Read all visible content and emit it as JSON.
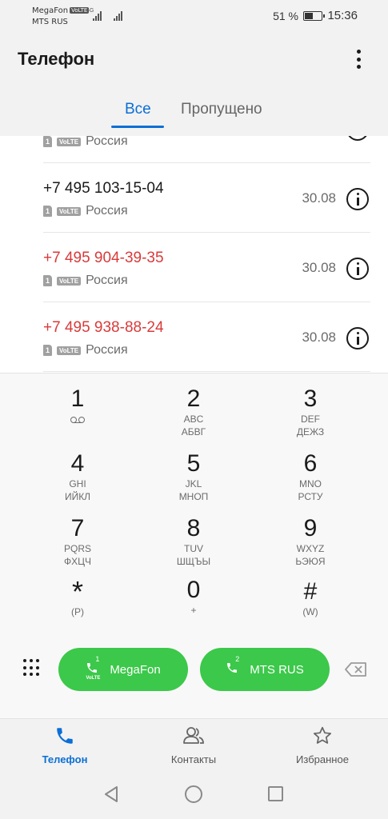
{
  "status_bar": {
    "carrier1": "MegaFon",
    "carrier1_tag": "VoLTE",
    "carrier2": "MTS RUS",
    "net1_tag": "4G",
    "battery": "51 %",
    "battery_level": 0.51,
    "time": "15:36"
  },
  "header": {
    "title": "Телефон",
    "more_icon": "more-vert-icon"
  },
  "tabs": [
    {
      "label": "Все",
      "active": true
    },
    {
      "label": "Пропущено",
      "active": false
    }
  ],
  "calls": [
    {
      "number": "",
      "country": "Россия",
      "date": "",
      "missed": false,
      "partial": true
    },
    {
      "number": "+7 495 103-15-04",
      "country": "Россия",
      "date": "30.08",
      "missed": false
    },
    {
      "number": "+7 495 904-39-35",
      "country": "Россия",
      "date": "30.08",
      "missed": true
    },
    {
      "number": "+7 495 938-88-24",
      "country": "Россия",
      "date": "30.08",
      "missed": true
    }
  ],
  "call_labels": {
    "sim": "1",
    "volte": "VoLTE"
  },
  "keypad": [
    {
      "digit": "1",
      "l1": "",
      "l2": "",
      "icon": "voicemail-icon"
    },
    {
      "digit": "2",
      "l1": "ABC",
      "l2": "АБВГ"
    },
    {
      "digit": "3",
      "l1": "DEF",
      "l2": "ДЕЖЗ"
    },
    {
      "digit": "4",
      "l1": "GHI",
      "l2": "ИЙКЛ"
    },
    {
      "digit": "5",
      "l1": "JKL",
      "l2": "МНОП"
    },
    {
      "digit": "6",
      "l1": "MNO",
      "l2": "РСТУ"
    },
    {
      "digit": "7",
      "l1": "PQRS",
      "l2": "ФХЦЧ"
    },
    {
      "digit": "8",
      "l1": "TUV",
      "l2": "ШЩЪЫ"
    },
    {
      "digit": "9",
      "l1": "WXYZ",
      "l2": "ЬЭЮЯ"
    },
    {
      "digit": "*",
      "l1": "(P)",
      "l2": ""
    },
    {
      "digit": "0",
      "l1": "+",
      "l2": ""
    },
    {
      "digit": "#",
      "l1": "(W)",
      "l2": ""
    }
  ],
  "call_buttons": {
    "sim1_label": "MegaFon",
    "sim1_num": "1",
    "sim1_volte": "VoLTE",
    "sim2_label": "MTS RUS",
    "sim2_num": "2",
    "color": "#3cc84a"
  },
  "bottom_nav": [
    {
      "label": "Телефон",
      "icon": "phone-icon",
      "active": true
    },
    {
      "label": "Контакты",
      "icon": "contacts-icon",
      "active": false
    },
    {
      "label": "Избранное",
      "icon": "star-icon",
      "active": false
    }
  ],
  "colors": {
    "accent": "#0a6fd6",
    "missed": "#d93a3a"
  }
}
